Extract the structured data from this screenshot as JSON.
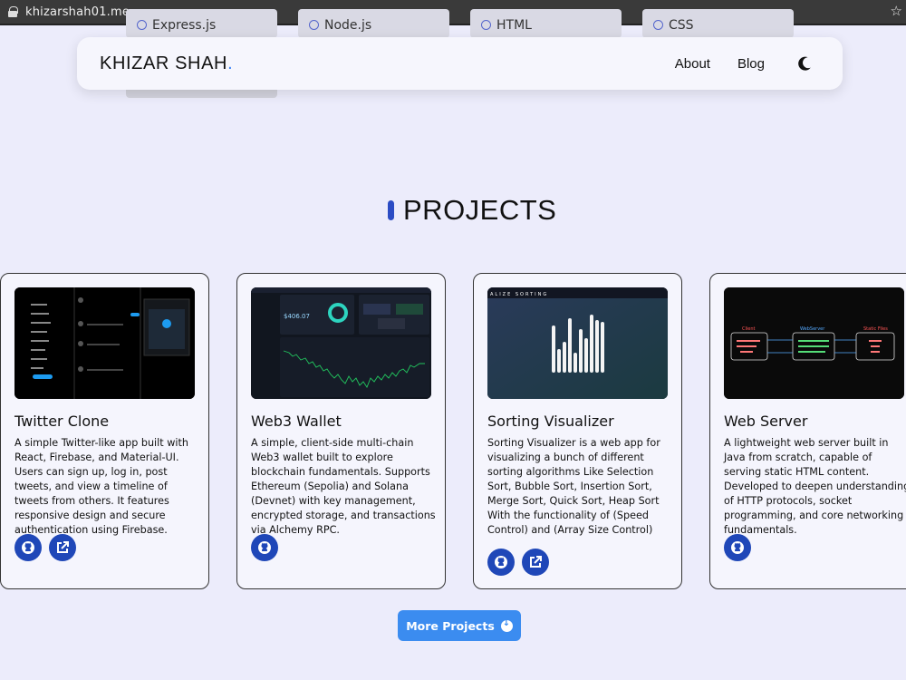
{
  "browser": {
    "url": "khizarshah01.me"
  },
  "skills": [
    {
      "label": "Express.js"
    },
    {
      "label": "Node.js"
    },
    {
      "label": "HTML"
    },
    {
      "label": "CSS"
    }
  ],
  "navbar": {
    "brand": "KHIZAR SHAH",
    "brand_dot": ".",
    "links": [
      "About",
      "Blog"
    ],
    "theme_icon": "moon-icon"
  },
  "projects_section": {
    "title": "PROJECTS",
    "cards": [
      {
        "title": "Twitter Clone",
        "description": "A simple Twitter-like app built with React, Firebase, and Material-UI. Users can sign up, log in, post tweets, and view a timeline of tweets from others. It features responsive design and secure authentication using Firebase.",
        "buttons": [
          "github-icon",
          "external-link-icon"
        ]
      },
      {
        "title": "Web3 Wallet",
        "description": "A simple, client-side multi-chain Web3 wallet built to explore blockchain fundamentals. Supports Ethereum (Sepolia) and Solana (Devnet) with key management, encrypted storage, and transactions via Alchemy RPC.",
        "buttons": [
          "github-icon"
        ],
        "thumb_balance": "$406.07"
      },
      {
        "title": "Sorting Visualizer",
        "description": "Sorting Visualizer is a web app for visualizing a bunch of different sorting algorithms Like Selection Sort, Bubble Sort, Insertion Sort, Merge Sort, Quick Sort, Heap Sort With the functionality of (Speed Control) and (Array Size Control)",
        "buttons": [
          "github-icon",
          "external-link-icon"
        ],
        "thumb_header": "ALIZE SORTING"
      },
      {
        "title": "Web Server",
        "description": "A lightweight web server built in Java from scratch, capable of serving static HTML content. Developed to deepen understanding of HTTP protocols, socket programming, and core networking fundamentals.",
        "buttons": [
          "github-icon"
        ],
        "thumb_labels": [
          "Client",
          "WebServer",
          "Static Files"
        ]
      }
    ],
    "more_button": "More Projects"
  },
  "colors": {
    "accent": "#1f47b8",
    "button": "#3b8cf0",
    "background": "#ececfb"
  }
}
